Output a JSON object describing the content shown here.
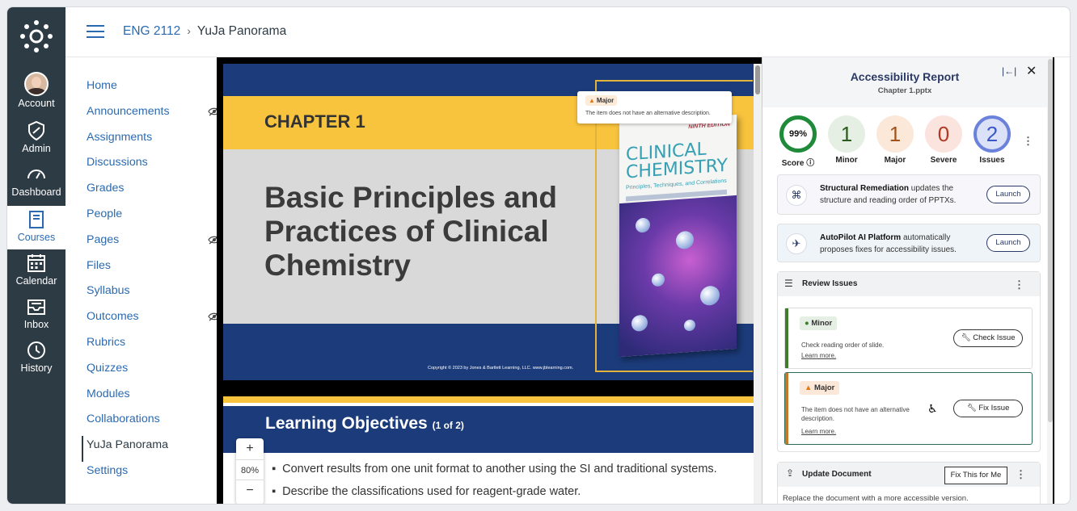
{
  "global_nav": {
    "items": [
      {
        "label": "Account",
        "icon": "avatar"
      },
      {
        "label": "Admin",
        "icon": "shield-icon"
      },
      {
        "label": "Dashboard",
        "icon": "dashboard-icon"
      },
      {
        "label": "Courses",
        "icon": "book-icon"
      },
      {
        "label": "Calendar",
        "icon": "calendar-icon"
      },
      {
        "label": "Inbox",
        "icon": "inbox-icon"
      },
      {
        "label": "History",
        "icon": "clock-icon"
      }
    ],
    "active": "Courses"
  },
  "breadcrumb": {
    "course": "ENG 2112",
    "separator": "›",
    "page": "YuJa Panorama"
  },
  "course_nav": {
    "items": [
      {
        "label": "Home"
      },
      {
        "label": "Announcements",
        "hidden": true
      },
      {
        "label": "Assignments"
      },
      {
        "label": "Discussions"
      },
      {
        "label": "Grades"
      },
      {
        "label": "People"
      },
      {
        "label": "Pages",
        "hidden": true
      },
      {
        "label": "Files"
      },
      {
        "label": "Syllabus"
      },
      {
        "label": "Outcomes",
        "hidden": true
      },
      {
        "label": "Rubrics"
      },
      {
        "label": "Quizzes"
      },
      {
        "label": "Modules"
      },
      {
        "label": "Collaborations"
      },
      {
        "label": "YuJa Panorama",
        "active": true
      },
      {
        "label": "Settings"
      }
    ]
  },
  "slide1": {
    "chapter": "CHAPTER 1",
    "title": "Basic Principles and Practices of Clinical Chemistry",
    "copyright": "Copyright © 2023 by Jones & Bartlett Learning, LLC. www.jblearning.com.",
    "book": {
      "edition": "NINTH EDITION",
      "title": "CLINICAL CHEMISTRY",
      "subtitle": "Principles, Techniques, and Correlations"
    },
    "tag": {
      "severity": "Major",
      "text": "The item does not have an alternative description."
    }
  },
  "slide2": {
    "title": "Learning Objectives",
    "title_suffix": "(1 of 2)",
    "bullets": [
      "Convert results from one unit format to another using the SI and traditional systems.",
      "Describe the classifications used for reagent-grade water."
    ]
  },
  "zoom": {
    "plus": "+",
    "value": "80%",
    "minus": "−"
  },
  "panel": {
    "title": "Accessibility Report",
    "file": "Chapter 1.pptx",
    "scores": {
      "score": {
        "value": "99%",
        "label": "Score",
        "fraction": 0.99
      },
      "minor": {
        "value": "1",
        "label": "Minor"
      },
      "major": {
        "value": "1",
        "label": "Major"
      },
      "severe": {
        "value": "0",
        "label": "Severe"
      },
      "issues": {
        "value": "2",
        "label": "Issues"
      }
    },
    "structural": {
      "bold": "Structural Remediation",
      "text": " updates the structure and reading order of PPTXs.",
      "button": "Launch"
    },
    "autopilot": {
      "bold": "AutoPilot AI Platform",
      "text": " automatically proposes fixes for accessibility issues.",
      "button": "Launch"
    },
    "review": {
      "title": "Review Issues",
      "issues": [
        {
          "severity": "Minor",
          "desc": "Check reading order of slide.",
          "learn": "Learn more.",
          "button": "Check Issue",
          "color": "#3f7d2a"
        },
        {
          "severity": "Major",
          "desc": "The item does not have an alternative description.",
          "learn": "Learn more.",
          "button": "Fix Issue",
          "color": "#c57a2a"
        }
      ]
    },
    "update": {
      "title": "Update Document",
      "button": "Fix This for Me",
      "desc": "Replace the document with a more accessible version."
    }
  }
}
